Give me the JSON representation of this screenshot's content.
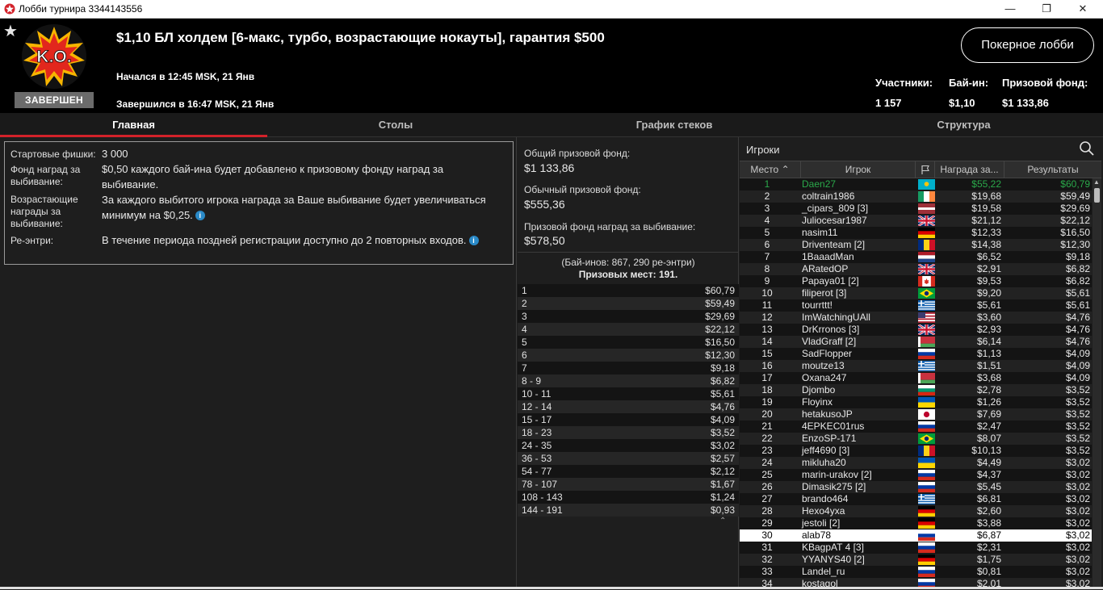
{
  "window": {
    "title": "Лобби турнира 3344143556"
  },
  "header": {
    "status": "ЗАВЕРШЕН",
    "logo_text": "K.O.",
    "title": "$1,10 БЛ холдем [6-макс, турбо, возрастающие нокауты], гарантия $500",
    "started": "Начался в 12:45 MSK, 21 Янв",
    "finished": "Завершился в 16:47 MSK, 21 Янв",
    "lobby_button": "Покерное лобби",
    "stats": [
      {
        "label": "Участники:",
        "value": "1 157"
      },
      {
        "label": "Бай-ин:",
        "value": "$1,10"
      },
      {
        "label": "Призовой фонд:",
        "value": "$1 133,86"
      }
    ]
  },
  "tabs": [
    "Главная",
    "Столы",
    "График стеков",
    "Структура"
  ],
  "info": [
    {
      "label": "Стартовые фишки:",
      "value": "3 000"
    },
    {
      "label": "Фонд наград за выбивание:",
      "value": "$0,50 каждого бай-ина будет добавлено к призовому фонду наград за выбивание."
    },
    {
      "label": "Возрастающие награды за выбивание:",
      "value": "За каждого выбитого игрока награда за Ваше выбивание будет увеличиваться минимум на $0,25."
    },
    {
      "label": "Ре-энтри:",
      "value": "В течение периода поздней регистрации доступно до 2 повторных входов."
    }
  ],
  "prize": {
    "total_label": "Общий призовой фонд:",
    "total_value": "$1 133,86",
    "regular_label": "Обычный призовой фонд:",
    "regular_value": "$555,36",
    "bounty_label": "Призовой фонд наград за выбивание:",
    "bounty_value": "$578,50",
    "buyins_note": "(Бай-инов: 867, 290 ре-энтри)",
    "places_note": "Призовых мест: 191.",
    "payouts": [
      [
        "1",
        "$60,79"
      ],
      [
        "2",
        "$59,49"
      ],
      [
        "3",
        "$29,69"
      ],
      [
        "4",
        "$22,12"
      ],
      [
        "5",
        "$16,50"
      ],
      [
        "6",
        "$12,30"
      ],
      [
        "7",
        "$9,18"
      ],
      [
        "8 - 9",
        "$6,82"
      ],
      [
        "10 - 11",
        "$5,61"
      ],
      [
        "12 - 14",
        "$4,76"
      ],
      [
        "15 - 17",
        "$4,09"
      ],
      [
        "18 - 23",
        "$3,52"
      ],
      [
        "24 - 35",
        "$3,02"
      ],
      [
        "36 - 53",
        "$2,57"
      ],
      [
        "54 - 77",
        "$2,12"
      ],
      [
        "78 - 107",
        "$1,67"
      ],
      [
        "108 - 143",
        "$1,24"
      ],
      [
        "144 - 191",
        "$0,93"
      ]
    ]
  },
  "players": {
    "title": "Игроки",
    "columns": [
      "Место",
      "Игрок",
      "Награда за...",
      "Результаты"
    ],
    "highlight_place": "30",
    "rows": [
      [
        "1",
        "Daen27",
        "kz",
        "$55,22",
        "$60,79"
      ],
      [
        "2",
        "coltrain1986",
        "ie",
        "$19,68",
        "$59,49"
      ],
      [
        "3",
        "_cipars_809 [3]",
        "lv",
        "$19,58",
        "$29,69"
      ],
      [
        "4",
        "Juliocesar1987",
        "gb",
        "$21,12",
        "$22,12"
      ],
      [
        "5",
        "nasim11",
        "de",
        "$12,33",
        "$16,50"
      ],
      [
        "6",
        "Driventeam [2]",
        "ro",
        "$14,38",
        "$12,30"
      ],
      [
        "7",
        "1BaaadMan",
        "nl",
        "$6,52",
        "$9,18"
      ],
      [
        "8",
        "ARatedOP",
        "gb",
        "$2,91",
        "$6,82"
      ],
      [
        "9",
        "Papaya01 [2]",
        "ca",
        "$9,53",
        "$6,82"
      ],
      [
        "10",
        "filiperot [3]",
        "br",
        "$9,20",
        "$5,61"
      ],
      [
        "11",
        "tourrttt!",
        "gr",
        "$5,61",
        "$5,61"
      ],
      [
        "12",
        "ImWatchingUAll",
        "us",
        "$3,60",
        "$4,76"
      ],
      [
        "13",
        "DrKrronos [3]",
        "gb",
        "$2,93",
        "$4,76"
      ],
      [
        "14",
        "VladGraff [2]",
        "by",
        "$6,14",
        "$4,76"
      ],
      [
        "15",
        "SadFlopper",
        "ru",
        "$1,13",
        "$4,09"
      ],
      [
        "16",
        "moutze13",
        "gr",
        "$1,51",
        "$4,09"
      ],
      [
        "17",
        "Oxana247",
        "by",
        "$3,68",
        "$4,09"
      ],
      [
        "18",
        "Djombo",
        "bg",
        "$2,78",
        "$3,52"
      ],
      [
        "19",
        "Floyinx",
        "ua",
        "$1,26",
        "$3,52"
      ],
      [
        "20",
        "hetakusoJP",
        "jp",
        "$7,69",
        "$3,52"
      ],
      [
        "21",
        "4EPKEC01rus",
        "ru",
        "$2,47",
        "$3,52"
      ],
      [
        "22",
        "EnzoSP-171",
        "br",
        "$8,07",
        "$3,52"
      ],
      [
        "23",
        "jeff4690 [3]",
        "ro",
        "$10,13",
        "$3,52"
      ],
      [
        "24",
        "mikluha20",
        "ua",
        "$4,49",
        "$3,02"
      ],
      [
        "25",
        "marin-urakov [2]",
        "ru",
        "$4,37",
        "$3,02"
      ],
      [
        "26",
        "Dimasik275 [2]",
        "ru",
        "$5,45",
        "$3,02"
      ],
      [
        "27",
        "brando464",
        "gr",
        "$6,81",
        "$3,02"
      ],
      [
        "28",
        "Hexo4yxa",
        "de",
        "$2,60",
        "$3,02"
      ],
      [
        "29",
        "jestoli [2]",
        "de",
        "$3,88",
        "$3,02"
      ],
      [
        "30",
        "alab78",
        "ru",
        "$6,87",
        "$3,02"
      ],
      [
        "31",
        "KBagpAT 4 [3]",
        "ru",
        "$2,31",
        "$3,02"
      ],
      [
        "32",
        "YYANYS40 [2]",
        "de",
        "$1,75",
        "$3,02"
      ],
      [
        "33",
        "Landel_ru",
        "ru",
        "$0,81",
        "$3,02"
      ],
      [
        "34",
        "kostagol",
        "ru",
        "$2,01",
        "$3,02"
      ]
    ]
  }
}
